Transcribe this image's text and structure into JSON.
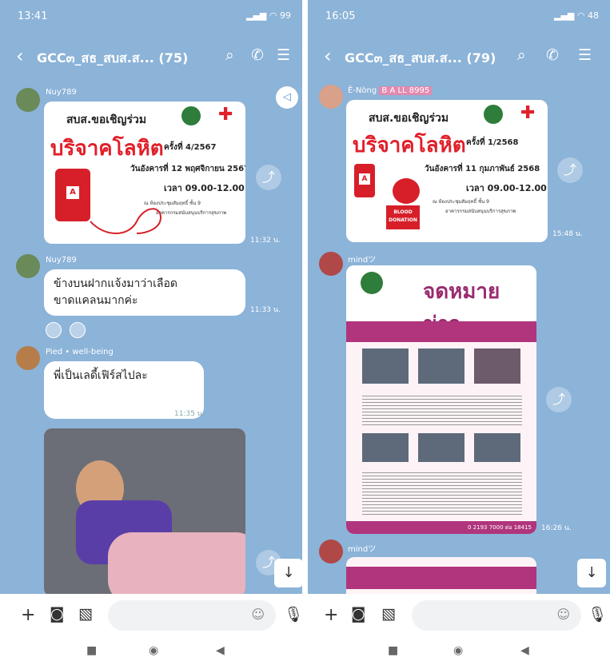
{
  "left": {
    "status_time": "13:41",
    "status_battery": "99",
    "chat_title": "GCC๓_สธ_สบส.ส... (75)",
    "messages": [
      {
        "sender": "Nuy789",
        "time": "11:32 น."
      },
      {
        "sender": "Nuy789",
        "text_line1": "ข้างบนฝากแจ้งมาว่าเลือด",
        "text_line2": "ขาดแคลนมากค่ะ",
        "time": "11:33 น."
      },
      {
        "sender": "Pied",
        "sender_extra": "well-being",
        "text": "พี่เป็นเลดี้เฟิร์สไปละ",
        "time": "11:35 น."
      }
    ],
    "poster": {
      "invite": "สบส.ขอเชิญร่วม",
      "headline": "บริจาคโลหิต",
      "round": "ครั้งที่ 4/2567",
      "date": "วันอังคารที่ 12 พฤศจิกายน 2567",
      "timespan": "เวลา 09.00-12.00 น.",
      "venue1": "ณ ห้องประชุมสัมฤทธิ์ ชั้น 9",
      "venue2": "อาคารกรมสนับสนุนบริการสุขภาพ",
      "bag_label": "A"
    }
  },
  "right": {
    "status_time": "16:05",
    "status_battery": "48",
    "chat_title": "GCC๓_สธ_สบส.ส... (79)",
    "messages": [
      {
        "sender": "Ê-Nòng",
        "sender_badge": "B A LL 8995",
        "time": "15:48 น."
      },
      {
        "sender": "mindツ",
        "time": "16:26 น."
      },
      {
        "sender": "mindツ"
      }
    ],
    "poster": {
      "invite": "สบส.ขอเชิญร่วม",
      "headline": "บริจาคโลหิต",
      "round": "ครั้งที่ 1/2568",
      "date": "วันอังคารที่ 11 กุมภาพันธ์ 2568",
      "timespan": "เวลา 09.00-12.00 น.",
      "venue1": "ณ ห้องประชุมสัมฤทธิ์ ชั้น 9",
      "venue2": "อาคารกรมสนับสนุนบริการสุขภาพ",
      "bag_label": "A",
      "blood_tag1": "BLOOD",
      "blood_tag2": "DONATION"
    },
    "newsletter": {
      "title": "จดหมายข่าว",
      "footer_phone": "0 2193 7000 ต่อ 18415"
    }
  },
  "colors": {
    "chat_bg": "#8cb3d8",
    "accent_red": "#e0202a",
    "newsletter_pink": "#9a2a6e"
  }
}
